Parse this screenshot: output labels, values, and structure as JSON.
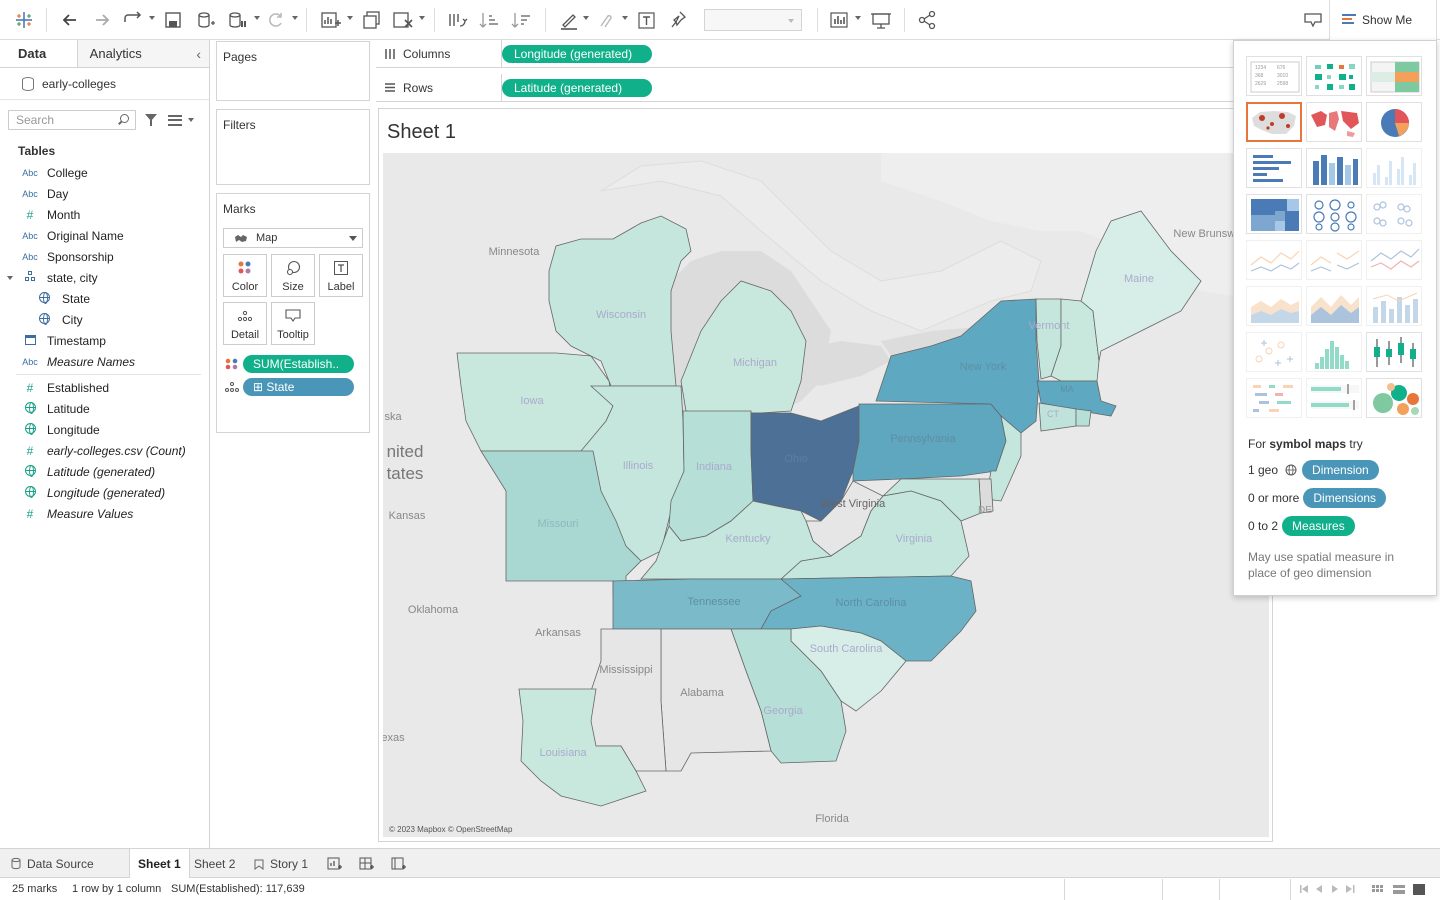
{
  "toolbar": {
    "show_me_label": "Show Me",
    "icons": [
      "tableau-logo-icon",
      "undo-icon",
      "redo-icon",
      "loop-icon",
      "save-icon",
      "new-datasource-icon",
      "pause-icon",
      "refresh-icon",
      "new-worksheet-icon",
      "duplicate-icon",
      "clear-icon",
      "swap-icon",
      "sort-asc-icon",
      "sort-desc-icon",
      "highlight-icon",
      "annotate-icon",
      "text-icon",
      "pin-icon",
      "fit-dropdown",
      "show-cards-icon",
      "presentation-icon",
      "share-icon",
      "tooltip-icon"
    ]
  },
  "left_panel": {
    "tabs": [
      "Data",
      "Analytics"
    ],
    "datasource": "early-colleges",
    "search_placeholder": "Search",
    "tables_heading": "Tables",
    "fields": [
      {
        "type": "Abc",
        "name": "College"
      },
      {
        "type": "Abc",
        "name": "Day"
      },
      {
        "type": "#",
        "name": "Month"
      },
      {
        "type": "Abc",
        "name": "Original Name"
      },
      {
        "type": "Abc",
        "name": "Sponsorship"
      },
      {
        "type": "hier",
        "name": "state, city"
      },
      {
        "type": "globe",
        "name": "State",
        "indent": true
      },
      {
        "type": "globe",
        "name": "City",
        "indent": true
      },
      {
        "type": "cal",
        "name": "Timestamp"
      },
      {
        "type": "Abc",
        "name": "Measure Names",
        "italic": true
      }
    ],
    "measures": [
      {
        "type": "#",
        "name": "Established"
      },
      {
        "type": "globe",
        "name": "Latitude"
      },
      {
        "type": "globe",
        "name": "Longitude"
      },
      {
        "type": "#",
        "name": "early-colleges.csv (Count)",
        "italic": true
      },
      {
        "type": "globe",
        "name": "Latitude (generated)",
        "italic": true
      },
      {
        "type": "globe",
        "name": "Longitude (generated)",
        "italic": true
      },
      {
        "type": "#",
        "name": "Measure Values",
        "italic": true
      }
    ]
  },
  "cards": {
    "pages": "Pages",
    "filters": "Filters",
    "marks": "Marks",
    "mark_type": "Map",
    "buttons": [
      "Color",
      "Size",
      "Label",
      "Detail",
      "Tooltip"
    ],
    "pills": [
      {
        "label": "SUM(Establish..",
        "kind": "measure"
      },
      {
        "label": "State",
        "kind": "dimension"
      }
    ]
  },
  "shelves": {
    "columns_label": "Columns",
    "columns_pill": "Longitude (generated)",
    "rows_label": "Rows",
    "rows_pill": "Latitude (generated)"
  },
  "view": {
    "sheet_title": "Sheet 1",
    "attribution": "© 2023 Mapbox © OpenStreetMap",
    "state_labels": [
      "Minnesota",
      "Wisconsin",
      "Michigan",
      "Iowa",
      "Illinois",
      "Indiana",
      "Ohio",
      "Pennsylvania",
      "New York",
      "Vermont",
      "Maine",
      "MA",
      "CT",
      "DE",
      "West Virginia",
      "Virginia",
      "Kentucky",
      "Missouri",
      "Kansas",
      "Oklahoma",
      "Arkansas",
      "Tennessee",
      "North Carolina",
      "South Carolina",
      "Georgia",
      "Alabama",
      "Mississippi",
      "Louisiana",
      "Florida",
      "New Brunswick",
      "nited",
      "tates",
      "ska",
      "exas"
    ],
    "legend_colors": {
      "low": "#d4ece6",
      "mid": "#a5d5d4",
      "high": "#5ba8bf",
      "max": "#4a6f94"
    }
  },
  "show_me": {
    "hint_prefix": "For ",
    "hint_bold": "symbol maps",
    "hint_suffix": " try",
    "rows": [
      {
        "prefix": "1 geo",
        "pill": "Dimension",
        "color": "#4a96b9"
      },
      {
        "prefix": "0 or more",
        "pill": "Dimensions",
        "color": "#4a96b9"
      },
      {
        "prefix": "0 to 2",
        "pill": "Measures",
        "color": "#10b08a"
      }
    ],
    "note": "May use spatial measure in place of geo dimension"
  },
  "sheet_tabs": {
    "items": [
      "Data Source",
      "Sheet 1",
      "Sheet 2",
      "Story 1"
    ],
    "active": "Sheet 1"
  },
  "status": {
    "marks": "25 marks",
    "dims": "1 row by 1 column",
    "sum": "SUM(Established): 117,639"
  }
}
